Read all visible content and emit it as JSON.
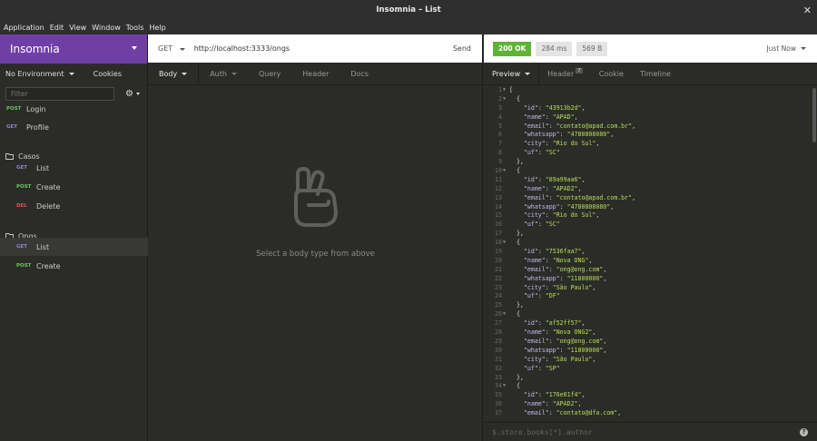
{
  "window": {
    "title": "Insomnia – List",
    "close": "✕"
  },
  "menu": [
    "Application",
    "Edit",
    "View",
    "Window",
    "Tools",
    "Help"
  ],
  "sidebar": {
    "workspace": "Insomnia",
    "environment": "No Environment",
    "cookies": "Cookies",
    "filter_placeholder": "Filter",
    "items": [
      {
        "type": "request",
        "method": "POST",
        "label": "Login"
      },
      {
        "type": "request",
        "method": "GET",
        "label": "Profile"
      },
      {
        "type": "folder",
        "label": "Casos"
      },
      {
        "type": "request",
        "method": "GET",
        "label": "List",
        "nested": true
      },
      {
        "type": "request",
        "method": "POST",
        "label": "Create",
        "nested": true
      },
      {
        "type": "request",
        "method": "DEL",
        "label": "Delete",
        "nested": true
      },
      {
        "type": "folder",
        "label": "Ongs"
      },
      {
        "type": "request",
        "method": "GET",
        "label": "List",
        "nested": true,
        "active": true
      },
      {
        "type": "request",
        "method": "POST",
        "label": "Create",
        "nested": true
      }
    ]
  },
  "request": {
    "method": "GET",
    "url": "http://localhost:3333/ongs",
    "send": "Send",
    "tabs": [
      "Body",
      "Auth",
      "Query",
      "Header",
      "Docs"
    ],
    "empty_message": "Select a body type from above"
  },
  "response": {
    "status": "200 OK",
    "time": "284 ms",
    "size": "569 B",
    "when": "Just Now",
    "tabs": [
      "Preview",
      "Header",
      "Cookie",
      "Timeline"
    ],
    "header_count": "7",
    "filter_placeholder": "$.store.books[*].author",
    "help": "?",
    "lines": [
      {
        "n": "1",
        "fold": true,
        "indent": "",
        "text": "["
      },
      {
        "n": "2",
        "fold": true,
        "indent": "  ",
        "text": "{"
      },
      {
        "n": "3",
        "indent": "    ",
        "key": "id",
        "val": "43913b2d",
        "comma": true
      },
      {
        "n": "4",
        "indent": "    ",
        "key": "name",
        "val": "APAD",
        "comma": true
      },
      {
        "n": "5",
        "indent": "    ",
        "key": "email",
        "val": "contato@apad.com.br",
        "comma": true
      },
      {
        "n": "6",
        "indent": "    ",
        "key": "whatsapp",
        "val": "4780808080",
        "comma": true
      },
      {
        "n": "7",
        "indent": "    ",
        "key": "city",
        "val": "Rio do Sul",
        "comma": true
      },
      {
        "n": "8",
        "indent": "    ",
        "key": "uf",
        "val": "SC"
      },
      {
        "n": "9",
        "indent": "  ",
        "text": "},"
      },
      {
        "n": "10",
        "fold": true,
        "indent": "  ",
        "text": "{"
      },
      {
        "n": "11",
        "indent": "    ",
        "key": "id",
        "val": "89a99aa6",
        "comma": true
      },
      {
        "n": "12",
        "indent": "    ",
        "key": "name",
        "val": "APAD2",
        "comma": true
      },
      {
        "n": "13",
        "indent": "    ",
        "key": "email",
        "val": "contato@apad.com.br",
        "comma": true
      },
      {
        "n": "14",
        "indent": "    ",
        "key": "whatsapp",
        "val": "4780808080",
        "comma": true
      },
      {
        "n": "15",
        "indent": "    ",
        "key": "city",
        "val": "Rio do Sul",
        "comma": true
      },
      {
        "n": "16",
        "indent": "    ",
        "key": "uf",
        "val": "SC"
      },
      {
        "n": "17",
        "indent": "  ",
        "text": "},"
      },
      {
        "n": "18",
        "fold": true,
        "indent": "  ",
        "text": "{"
      },
      {
        "n": "19",
        "indent": "    ",
        "key": "id",
        "val": "7536faa7",
        "comma": true
      },
      {
        "n": "20",
        "indent": "    ",
        "key": "name",
        "val": "Nova ONG",
        "comma": true
      },
      {
        "n": "21",
        "indent": "    ",
        "key": "email",
        "val": "ong@ong.com",
        "comma": true
      },
      {
        "n": "22",
        "indent": "    ",
        "key": "whatsapp",
        "val": "11800000",
        "comma": true
      },
      {
        "n": "23",
        "indent": "    ",
        "key": "city",
        "val": "São Paulo",
        "comma": true
      },
      {
        "n": "24",
        "indent": "    ",
        "key": "uf",
        "val": "DF"
      },
      {
        "n": "25",
        "indent": "  ",
        "text": "},"
      },
      {
        "n": "26",
        "fold": true,
        "indent": "  ",
        "text": "{"
      },
      {
        "n": "27",
        "indent": "    ",
        "key": "id",
        "val": "af52ff57",
        "comma": true
      },
      {
        "n": "28",
        "indent": "    ",
        "key": "name",
        "val": "Nova ONG2",
        "comma": true
      },
      {
        "n": "29",
        "indent": "    ",
        "key": "email",
        "val": "ong@ong.com",
        "comma": true
      },
      {
        "n": "30",
        "indent": "    ",
        "key": "whatsapp",
        "val": "11800000",
        "comma": true
      },
      {
        "n": "31",
        "indent": "    ",
        "key": "city",
        "val": "São Paulo",
        "comma": true
      },
      {
        "n": "32",
        "indent": "    ",
        "key": "uf",
        "val": "SP"
      },
      {
        "n": "33",
        "indent": "  ",
        "text": "},"
      },
      {
        "n": "34",
        "fold": true,
        "indent": "  ",
        "text": "{"
      },
      {
        "n": "35",
        "indent": "    ",
        "key": "id",
        "val": "176e01f4",
        "comma": true
      },
      {
        "n": "36",
        "indent": "    ",
        "key": "name",
        "val": "APAD2",
        "comma": true
      },
      {
        "n": "37",
        "indent": "    ",
        "key": "email",
        "val": "contato@dfa.com",
        "comma": true
      }
    ]
  }
}
